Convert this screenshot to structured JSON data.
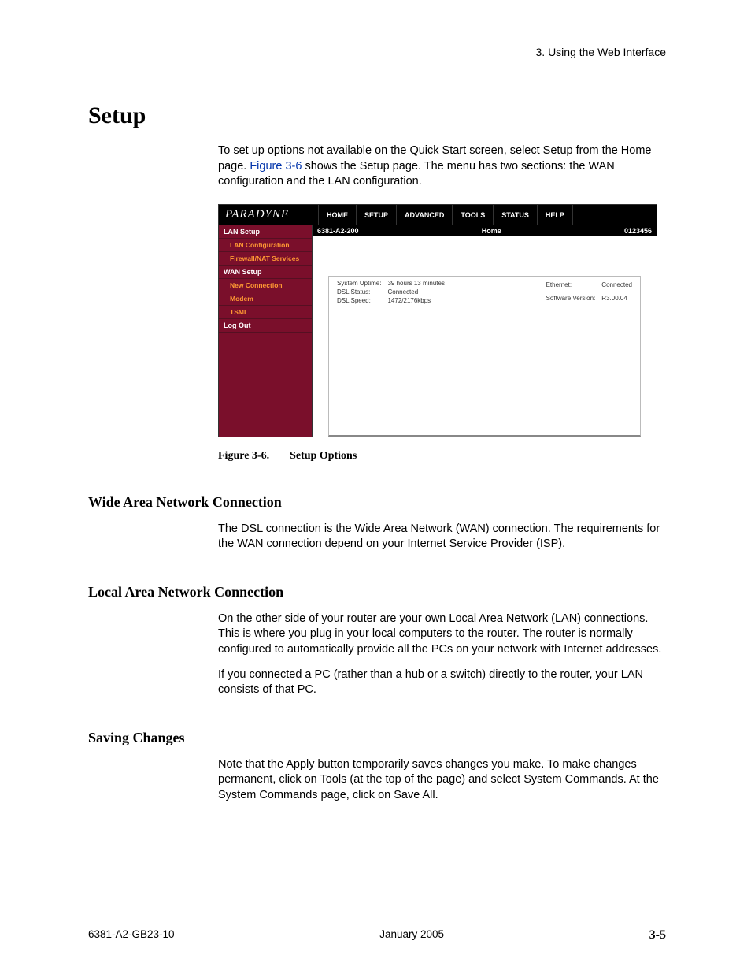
{
  "header": {
    "chapter": "3. Using the Web Interface"
  },
  "title": "Setup",
  "intro": {
    "pre": "To set up options not available on the Quick Start screen, select Setup from the Home page. ",
    "xref": "Figure 3-6",
    "post": " shows the Setup page. The menu has two sections: the WAN configuration and the LAN configuration."
  },
  "router": {
    "brand": "PARADYNE",
    "tabs": [
      "HOME",
      "SETUP",
      "ADVANCED",
      "TOOLS",
      "STATUS",
      "HELP"
    ],
    "sidebar": [
      {
        "label": "LAN Setup",
        "sub": false
      },
      {
        "label": "LAN Configuration",
        "sub": true
      },
      {
        "label": "Firewall/NAT Services",
        "sub": true
      },
      {
        "label": "WAN Setup",
        "sub": false
      },
      {
        "label": "New Connection",
        "sub": true
      },
      {
        "label": "Modem",
        "sub": true
      },
      {
        "label": "TSML",
        "sub": true
      },
      {
        "label": "Log Out",
        "sub": false
      }
    ],
    "content_header": {
      "left": "6381-A2-200",
      "center": "Home",
      "right": "0123456"
    },
    "status_left": [
      {
        "k": "System Uptime:",
        "v": "39 hours 13 minutes"
      },
      {
        "k": "DSL Status:",
        "v": "Connected"
      },
      {
        "k": "DSL Speed:",
        "v": "1472/2176kbps"
      }
    ],
    "status_right": [
      {
        "k": "Ethernet:",
        "v": "Connected"
      },
      {
        "k": "Software Version:",
        "v": "R3.00.04"
      }
    ]
  },
  "caption": {
    "label": "Figure 3-6.",
    "title": "Setup Options"
  },
  "sections": {
    "wan": {
      "heading": "Wide Area Network Connection",
      "p1": "The DSL connection is the Wide Area Network (WAN) connection. The requirements for the WAN connection depend on your Internet Service Provider (ISP)."
    },
    "lan": {
      "heading": "Local Area Network Connection",
      "p1": "On the other side of your router are your own Local Area Network (LAN) connections. This is where you plug in your local computers to the router. The router is normally configured to automatically provide all the PCs on your network with Internet addresses.",
      "p2": "If you connected a PC (rather than a hub or a switch) directly to the router, your LAN consists of that PC."
    },
    "save": {
      "heading": "Saving Changes",
      "p1": "Note that the Apply button temporarily saves changes you make. To make changes permanent, click on Tools (at the top of the page) and select System Commands. At the System Commands page, click on Save All."
    }
  },
  "footer": {
    "left": "6381-A2-GB23-10",
    "center": "January 2005",
    "right": "3-5"
  }
}
